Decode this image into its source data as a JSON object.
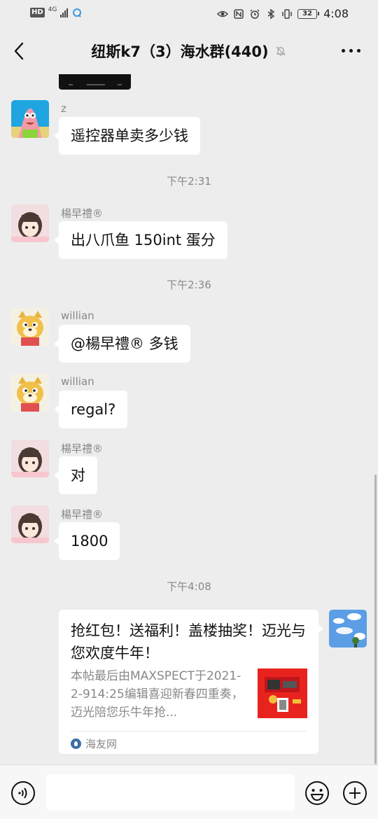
{
  "status_bar": {
    "hd": "HD",
    "network": "4G",
    "battery": "32",
    "time": "4:08"
  },
  "header": {
    "title": "纽斯k7（3）海水群(440)",
    "back_icon": "chevron-left-icon",
    "mute_icon": "bell-off-icon",
    "more_icon": "more-icon"
  },
  "messages": [
    {
      "nick": "z",
      "text": "遥控器单卖多少钱"
    },
    {
      "time": "下午2:31"
    },
    {
      "nick": "楊早禮®",
      "text": "出八爪鱼 150int 蛋分"
    },
    {
      "time": "下午2:36"
    },
    {
      "nick": "willian",
      "text": "@楊早禮®  多钱"
    },
    {
      "nick": "willian",
      "text": "regal?"
    },
    {
      "nick": "楊早禮®",
      "text": "对"
    },
    {
      "nick": "楊早禮®",
      "text": "1800"
    },
    {
      "time": "下午4:08"
    }
  ],
  "card": {
    "title": "抢红包！送福利！盖楼抽奖！迈光与您欢度牛年！",
    "description": "本帖最后由MAXSPECT于2021-2-914:25编辑喜迎新春四重奏，迈光陪您乐牛年抢...",
    "source": "海友网"
  },
  "input": {
    "placeholder": "",
    "voice_icon": "voice-icon",
    "emoji_icon": "emoji-icon",
    "plus_icon": "plus-icon"
  }
}
